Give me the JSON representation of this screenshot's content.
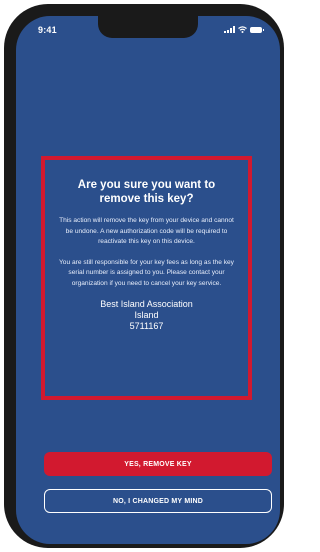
{
  "status_bar": {
    "time": "9:41"
  },
  "dialog": {
    "title": "Are you sure you want to remove this key?",
    "paragraph1": "This action will remove the key from your device and cannot be undone. A new authorization code will be required to reactivate this key on this device.",
    "paragraph2": "You are still responsible for your key fees as long as the key serial number is assigned to you. Please contact your organization if you need to cancel your key service.",
    "org_name": "Best Island Association",
    "org_location": "Island",
    "serial_number": "5711167"
  },
  "actions": {
    "confirm_label": "YES, REMOVE KEY",
    "cancel_label": "NO, I CHANGED MY MIND"
  },
  "colors": {
    "background": "#2b4f8c",
    "accent": "#d2192f",
    "text": "#ffffff"
  },
  "icons": [
    "signal-icon",
    "wifi-icon",
    "battery-icon"
  ]
}
